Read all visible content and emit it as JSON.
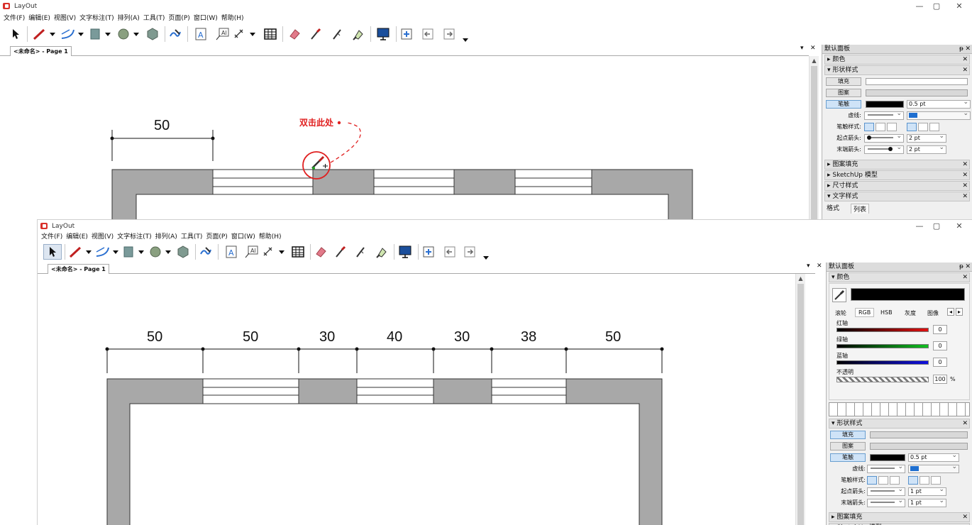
{
  "app": {
    "title": "LayOut"
  },
  "window_controls": {
    "minimize": "—",
    "restore": "▢",
    "close": "✕"
  },
  "menu": [
    "文件(F)",
    "编辑(E)",
    "视图(V)",
    "文字标注(T)",
    "排列(A)",
    "工具(T)",
    "页面(P)",
    "窗口(W)",
    "帮助(H)"
  ],
  "tab": {
    "label": "<未命名> - Page 1"
  },
  "tab_controls": {
    "dropdown": "▾",
    "close": "✕"
  },
  "panel": {
    "title": "默认面板",
    "pin": "ᵽ",
    "close": "✕",
    "sections": {
      "color": "颜色",
      "shape_style": "形状样式",
      "pattern_fill": "图案填充",
      "sketchup_model": "SketchUp 模型",
      "dimension_style": "尺寸样式",
      "text_style": "文字样式"
    },
    "shape_style": {
      "fill": "填充",
      "pattern": "图案",
      "stroke": "笔触",
      "dash": "虚线:",
      "stroke_style": "笔触样式:",
      "start_arrow": "起点箭头:",
      "end_arrow": "末端箭头:",
      "stroke_width": "0.5 pt",
      "arrow_size_top": "2 pt",
      "arrow_size_bottom": "1 pt"
    },
    "text_style_tabs": {
      "format": "格式",
      "list": "列表"
    },
    "color_picker": {
      "tabs": [
        "滚轮",
        "RGB",
        "HSB",
        "灰度",
        "图像"
      ],
      "channels": [
        {
          "label": "红轴",
          "value": "0",
          "color": "#e01010"
        },
        {
          "label": "绿轴",
          "value": "0",
          "color": "#10c020"
        },
        {
          "label": "蓝轴",
          "value": "0",
          "color": "#1010e0"
        }
      ],
      "opacity_label": "不透明",
      "opacity_value": "100",
      "opacity_unit": "%",
      "current": "#000000"
    }
  },
  "callout": {
    "text": "双击此处"
  },
  "colors": {
    "wall": "#a8a8a8",
    "callout": "#e02020",
    "accent_blue": "#1f6fd0"
  },
  "top_dimension": "50",
  "bottom_dimensions": [
    "50",
    "50",
    "30",
    "40",
    "30",
    "38",
    "50"
  ]
}
